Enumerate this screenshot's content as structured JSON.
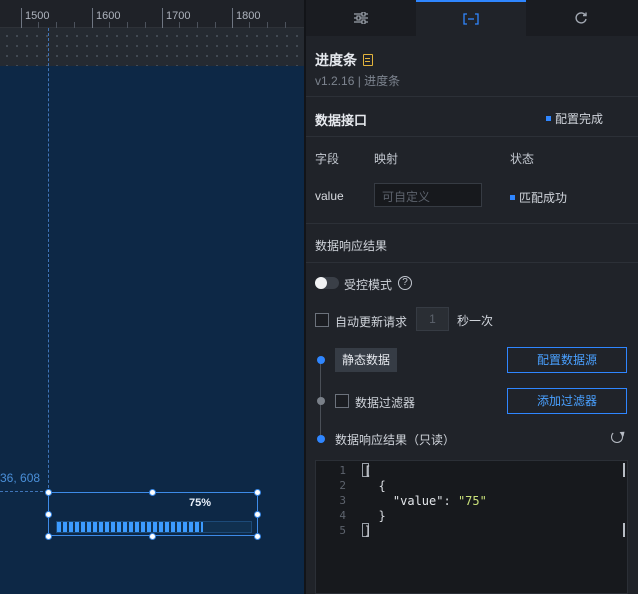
{
  "canvas": {
    "ruler_labels": [
      "1500",
      "1600",
      "1700",
      "1800"
    ],
    "coordinate_readout": "36, 608",
    "progress_widget": {
      "percent_label": "75%",
      "value": 0.75
    }
  },
  "panel": {
    "tabs": [
      {
        "name": "style",
        "icon": "sliders-icon"
      },
      {
        "name": "data",
        "icon": "data-bracket-icon"
      },
      {
        "name": "interaction",
        "icon": "refresh-interaction-icon"
      }
    ],
    "component_title": "进度条",
    "version_line": "v1.2.16 | 进度条",
    "data_interface": {
      "heading": "数据接口",
      "status": "配置完成",
      "columns": {
        "field": "字段",
        "mapping": "映射",
        "state": "状态"
      },
      "row": {
        "field": "value",
        "mapping_placeholder": "可自定义",
        "state": "匹配成功"
      }
    },
    "response": {
      "heading": "数据响应结果",
      "controlled_mode": "受控模式",
      "auto_update": "自动更新请求",
      "interval_value": "1",
      "interval_unit": "秒一次",
      "static_data": "静态数据",
      "config_source_button": "配置数据源",
      "data_filter": "数据过滤器",
      "add_filter_button": "添加过滤器",
      "result_readonly": "数据响应结果（只读）"
    },
    "code": {
      "line_numbers": [
        "1",
        "2",
        "3",
        "4",
        "5"
      ],
      "lines": [
        "[",
        "  {",
        "    \"value\": \"75\"",
        "  }",
        "]"
      ],
      "key": "\"value\"",
      "value": "\"75\""
    }
  },
  "colors": {
    "accent": "#2f86ff",
    "canvas_bg": "#0d2846",
    "panel_bg": "#202329",
    "progress_fill": "#3c9bff"
  }
}
